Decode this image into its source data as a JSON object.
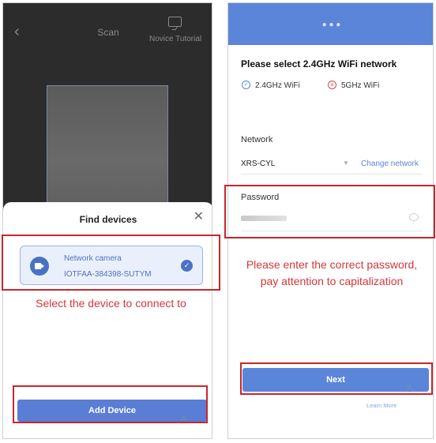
{
  "scan_screen": {
    "title": "Scan",
    "tutorial_label": "Novice Tutorial",
    "tutorial_icon": "video-chat-icon",
    "back_icon": "chevron-left-icon"
  },
  "find_devices": {
    "title": "Find devices",
    "close_icon": "close-icon",
    "device": {
      "name": "Network camera",
      "id": "IOTFAA-384398-SUTYM",
      "icon": "camera-icon",
      "selected": true
    },
    "add_button_label": "Add Device"
  },
  "wifi_screen": {
    "heading": "Please select 2.4GHz WiFi network",
    "supported_label": "2.4GHz WiFi",
    "unsupported_label": "5GHz WiFi",
    "network_label": "Network",
    "network_value": "XRS-CYL",
    "change_network_label": "Change network",
    "password_label": "Password",
    "next_button_label": "Next",
    "learn_more_label": "Learn More"
  },
  "annotations": {
    "select_device": "Select the device to connect to",
    "password_hint_line1": "Please enter the correct password,",
    "password_hint_line2": "pay attention to capitalization"
  },
  "colors": {
    "primary": "#5b85d8",
    "highlight": "#c8262b",
    "camera_bg": "#2c2c2c"
  }
}
